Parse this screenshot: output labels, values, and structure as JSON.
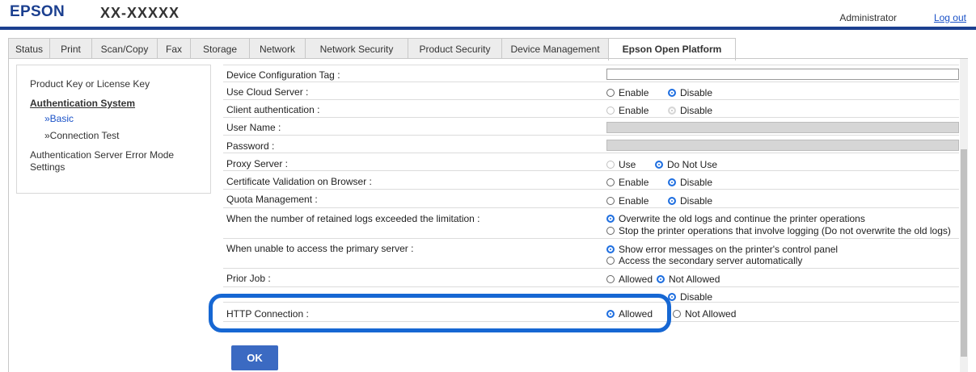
{
  "header": {
    "brand": "EPSON",
    "model": "XX-XXXXX",
    "user": "Administrator",
    "logout": "Log out"
  },
  "tabs": [
    {
      "label": "Status"
    },
    {
      "label": "Print"
    },
    {
      "label": "Scan/Copy"
    },
    {
      "label": "Fax"
    },
    {
      "label": "Storage"
    },
    {
      "label": "Network"
    },
    {
      "label": "Network Security"
    },
    {
      "label": "Product Security"
    },
    {
      "label": "Device Management"
    },
    {
      "label": "Epson Open Platform"
    }
  ],
  "active_tab": "Epson Open Platform",
  "sidebar": {
    "product_key": "Product Key or License Key",
    "auth_system": "Authentication System",
    "basic": "»Basic",
    "connection_test": "»Connection Test",
    "error_mode_line1": "Authentication Server Error Mode",
    "error_mode_line2": "Settings"
  },
  "settings": {
    "device_tag": {
      "label": "Device Configuration Tag :",
      "value": ""
    },
    "cloud": {
      "label": "Use Cloud Server :",
      "opt1": "Enable",
      "opt2": "Disable",
      "selected": "Disable"
    },
    "client_auth": {
      "label": "Client authentication :",
      "opt1": "Enable",
      "opt2": "Disable",
      "selected": "Disable",
      "disabled": true
    },
    "user_name": {
      "label": "User Name :",
      "value": ""
    },
    "password": {
      "label": "Password :",
      "value": ""
    },
    "proxy": {
      "label": "Proxy Server :",
      "opt1": "Use",
      "opt2": "Do Not Use",
      "selected": "Do Not Use"
    },
    "cert": {
      "label": "Certificate Validation on Browser :",
      "opt1": "Enable",
      "opt2": "Disable",
      "selected": "Disable"
    },
    "quota": {
      "label": "Quota Management :",
      "opt1": "Enable",
      "opt2": "Disable",
      "selected": "Disable"
    },
    "logs": {
      "label": "When the number of retained logs exceeded the limitation :",
      "opt1": "Overwrite the old logs and continue the printer operations",
      "opt2": "Stop the printer operations that involve logging (Do not overwrite the old logs)",
      "selected": "Overwrite the old logs and continue the printer operations"
    },
    "primary": {
      "label": "When unable to access the primary server :",
      "opt1": "Show error messages on the printer's control panel",
      "opt2": "Access the secondary server automatically",
      "selected": "Show error messages on the printer's control panel"
    },
    "prior_job": {
      "label": "Prior Job :",
      "opt1": "Allowed",
      "opt2": "Not Allowed",
      "selected": "Not Allowed"
    },
    "hidden_row": {
      "opt2": "Disable",
      "selected": "Disable"
    },
    "http": {
      "label": "HTTP Connection :",
      "opt1": "Allowed",
      "opt2": "Not Allowed",
      "selected": "Allowed"
    }
  },
  "ok_button": "OK",
  "colors": {
    "brand_blue": "#1b3f8f",
    "highlight": "#1667d3",
    "button": "#3b6ac2",
    "link": "#1a52c8"
  }
}
